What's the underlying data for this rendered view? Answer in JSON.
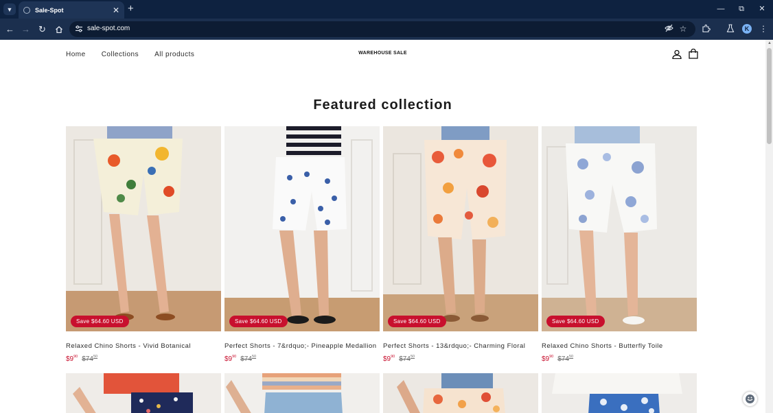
{
  "browser": {
    "tab_title": "Sale-Spot",
    "url": "sale-spot.com",
    "profile_initial": "K"
  },
  "site": {
    "nav": [
      "Home",
      "Collections",
      "All products"
    ],
    "logo": "WAREHOUSE SALE"
  },
  "section_title": "Featured collection",
  "products": [
    {
      "title": "Relaxed Chino Shorts - Vivid Botanical",
      "badge": "Save $64.60 USD",
      "price_main": "$9",
      "price_cents": "90",
      "orig_main": "$74",
      "orig_cents": "50",
      "pattern": "botanical"
    },
    {
      "title": "Perfect Shorts - 7&rdquo;- Pineapple Medallion",
      "badge": "Save $64.60 USD",
      "price_main": "$9",
      "price_cents": "90",
      "orig_main": "$74",
      "orig_cents": "50",
      "pattern": "pineapple"
    },
    {
      "title": "Perfect Shorts - 13&rdquo;- Charming Floral",
      "badge": "Save $64.60 USD",
      "price_main": "$9",
      "price_cents": "90",
      "orig_main": "$74",
      "orig_cents": "50",
      "pattern": "floral"
    },
    {
      "title": "Relaxed Chino Shorts - Butterfly Toile",
      "badge": "Save $64.60 USD",
      "price_main": "$9",
      "price_cents": "90",
      "orig_main": "$74",
      "orig_cents": "50",
      "pattern": "toile"
    }
  ],
  "colors": {
    "sale_red": "#c8102e",
    "browser_dark": "#0e2240",
    "browser_toolbar": "#1b2f4e"
  }
}
